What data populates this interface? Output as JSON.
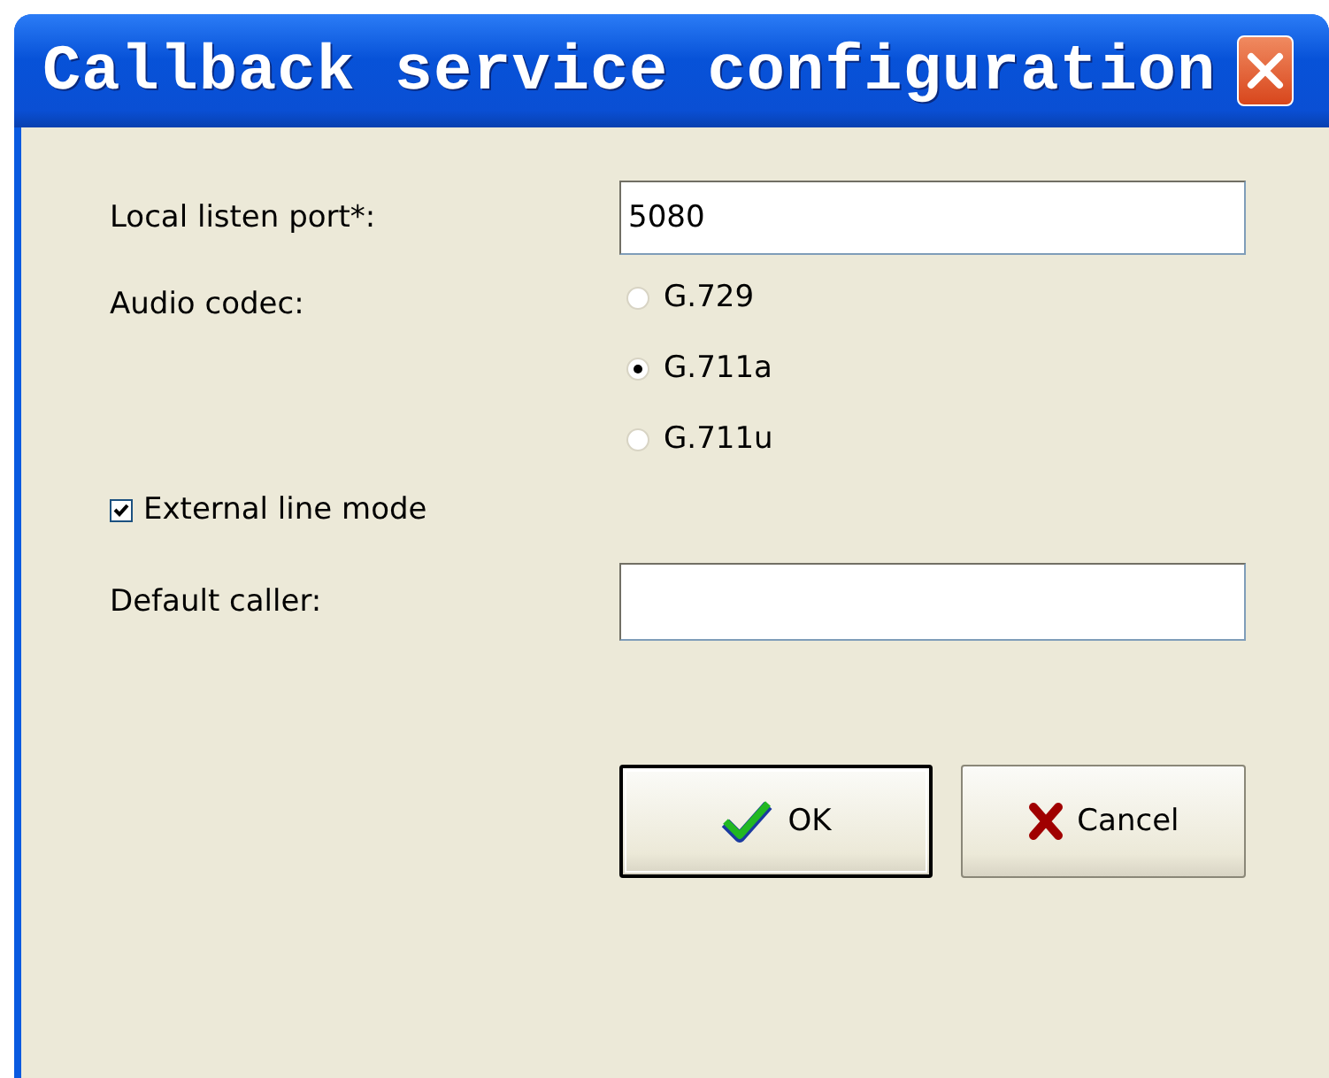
{
  "window": {
    "title": "Callback service configuration"
  },
  "port": {
    "label": "Local listen port*:",
    "value": "5080"
  },
  "codec": {
    "label": "Audio codec:",
    "options": [
      {
        "label": "G.729",
        "selected": false
      },
      {
        "label": "G.711a",
        "selected": true
      },
      {
        "label": "G.711u",
        "selected": false
      }
    ]
  },
  "external_line": {
    "label": "External line mode",
    "checked": true
  },
  "caller": {
    "label": "Default caller:"
  },
  "buttons": [
    {
      "label": "OK",
      "kind": "ok",
      "default": true
    },
    {
      "label": "Cancel",
      "kind": "cancel",
      "default": false
    }
  ]
}
